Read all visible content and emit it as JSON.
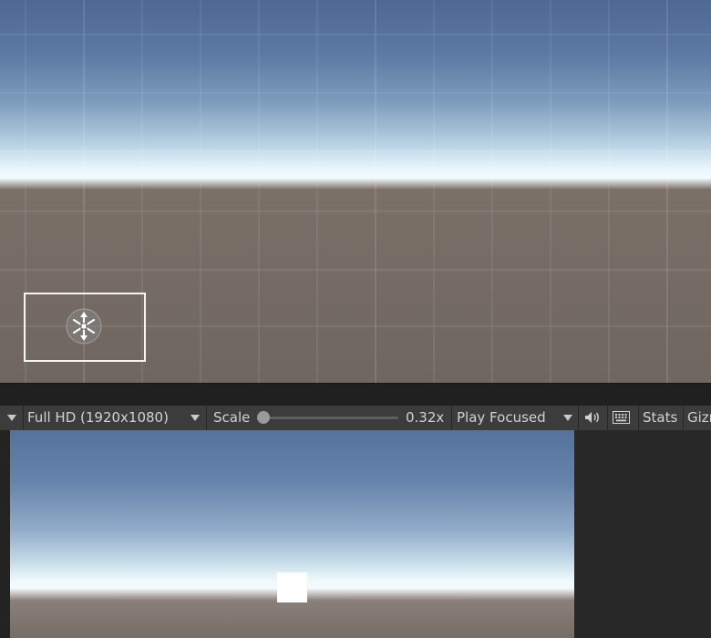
{
  "game_toolbar": {
    "resolution_label": "Full HD (1920x1080)",
    "scale_label": "Scale",
    "scale_value": "0.32x",
    "scale_slider_fraction": 0.0,
    "play_mode_label": "Play Focused",
    "stats_label": "Stats",
    "gizmos_label": "Gizm",
    "icons": [
      "dropdown-caret-icon",
      "speaker-icon",
      "keyboard-icon"
    ]
  },
  "colors": {
    "sky_top": "#4e6992",
    "horizon": "#f4fbfd",
    "ground": "#6f6660",
    "toolbar_bg": "#3c3c3c",
    "panel_bg": "#282828",
    "selection_outline": "#f4f4f4"
  }
}
